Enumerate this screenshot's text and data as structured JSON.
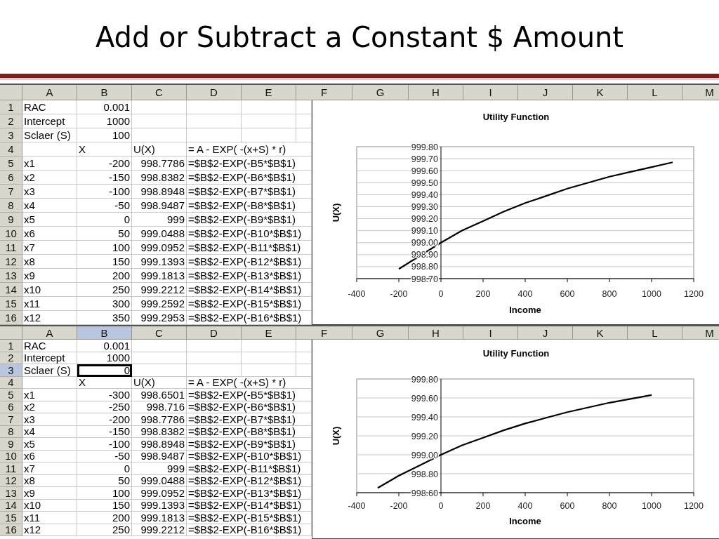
{
  "slide": {
    "title": "Add or Subtract a Constant $ Amount"
  },
  "sheets": [
    {
      "columns": [
        {
          "label": "A",
          "selected": false
        },
        {
          "label": "B",
          "selected": false
        },
        {
          "label": "C",
          "selected": false
        },
        {
          "label": "D",
          "selected": false
        },
        {
          "label": "E",
          "selected": false
        },
        {
          "label": "F",
          "selected": false
        },
        {
          "label": "G",
          "selected": false
        },
        {
          "label": "H",
          "selected": false
        },
        {
          "label": "I",
          "selected": false
        },
        {
          "label": "J",
          "selected": false
        },
        {
          "label": "K",
          "selected": false
        },
        {
          "label": "L",
          "selected": false
        },
        {
          "label": "M",
          "selected": false
        }
      ],
      "rows": [
        {
          "number": "1",
          "kind": "value",
          "selected": false,
          "a": "RAC",
          "b": "0.001"
        },
        {
          "number": "2",
          "kind": "value",
          "selected": false,
          "a": "Intercept",
          "b": "1000"
        },
        {
          "number": "3",
          "kind": "value",
          "selected": false,
          "a": "Sclaer (S)",
          "b": "100"
        },
        {
          "number": "4",
          "kind": "heading",
          "selected": false,
          "b": "X",
          "c": "U(X)",
          "d": "= A - EXP( -(x+S) * r)"
        },
        {
          "number": "5",
          "kind": "value",
          "selected": false,
          "a": "x1",
          "b": "-200",
          "c": "998.7786",
          "d": "=$B$2-EXP(-B5*$B$1)"
        },
        {
          "number": "6",
          "kind": "value",
          "selected": false,
          "a": "x2",
          "b": "-150",
          "c": "998.8382",
          "d": "=$B$2-EXP(-B6*$B$1)"
        },
        {
          "number": "7",
          "kind": "value",
          "selected": false,
          "a": "x3",
          "b": "-100",
          "c": "998.8948",
          "d": "=$B$2-EXP(-B7*$B$1)"
        },
        {
          "number": "8",
          "kind": "value",
          "selected": false,
          "a": "x4",
          "b": "-50",
          "c": "998.9487",
          "d": "=$B$2-EXP(-B8*$B$1)"
        },
        {
          "number": "9",
          "kind": "value",
          "selected": false,
          "a": "x5",
          "b": "0",
          "c": "999",
          "d": "=$B$2-EXP(-B9*$B$1)"
        },
        {
          "number": "10",
          "kind": "value",
          "selected": false,
          "a": "x6",
          "b": "50",
          "c": "999.0488",
          "d": "=$B$2-EXP(-B10*$B$1)"
        },
        {
          "number": "11",
          "kind": "value",
          "selected": false,
          "a": "x7",
          "b": "100",
          "c": "999.0952",
          "d": "=$B$2-EXP(-B11*$B$1)"
        },
        {
          "number": "12",
          "kind": "value",
          "selected": false,
          "a": "x8",
          "b": "150",
          "c": "999.1393",
          "d": "=$B$2-EXP(-B12*$B$1)"
        },
        {
          "number": "13",
          "kind": "value",
          "selected": false,
          "a": "x9",
          "b": "200",
          "c": "999.1813",
          "d": "=$B$2-EXP(-B13*$B$1)"
        },
        {
          "number": "14",
          "kind": "value",
          "selected": false,
          "a": "x10",
          "b": "250",
          "c": "999.2212",
          "d": "=$B$2-EXP(-B14*$B$1)"
        },
        {
          "number": "15",
          "kind": "value",
          "selected": false,
          "a": "x11",
          "b": "300",
          "c": "999.2592",
          "d": "=$B$2-EXP(-B15*$B$1)"
        },
        {
          "number": "16",
          "kind": "value",
          "selected": false,
          "a": "x12",
          "b": "350",
          "c": "999.2953",
          "d": "=$B$2-EXP(-B16*$B$1)"
        }
      ],
      "chart": {
        "chart_data": {
          "type": "line",
          "title": "Utility Function",
          "xlabel": "Income",
          "ylabel": "U(X)",
          "x": [
            -200,
            -100,
            0,
            100,
            200,
            300,
            400,
            500,
            600,
            700,
            800,
            900,
            1000,
            1100
          ],
          "values": [
            998.78,
            998.89,
            999,
            999.1,
            999.18,
            999.26,
            999.33,
            999.39,
            999.45,
            999.5,
            999.55,
            999.59,
            999.63,
            999.67
          ],
          "grid": true,
          "xlim": [
            -400,
            1200
          ],
          "ylim": [
            998.7,
            999.8
          ],
          "xticks": [
            -400,
            -200,
            0,
            200,
            400,
            600,
            800,
            1000,
            1200
          ],
          "yticks": [
            {
              "value": 998.7,
              "label": "998.70"
            },
            {
              "value": 998.8,
              "label": "998.80"
            },
            {
              "value": 998.9,
              "label": "998.90"
            },
            {
              "value": 999.0,
              "label": "999.00"
            },
            {
              "value": 999.1,
              "label": "999.10"
            },
            {
              "value": 999.2,
              "label": "999.20"
            },
            {
              "value": 999.3,
              "label": "999.30"
            },
            {
              "value": 999.4,
              "label": "999.40"
            },
            {
              "value": 999.5,
              "label": "999.50"
            },
            {
              "value": 999.6,
              "label": "999.60"
            },
            {
              "value": 999.7,
              "label": "999.70"
            },
            {
              "value": 999.8,
              "label": "999.80"
            }
          ]
        }
      }
    },
    {
      "columns": [
        {
          "label": "A",
          "selected": false
        },
        {
          "label": "B",
          "selected": true
        },
        {
          "label": "C",
          "selected": false
        },
        {
          "label": "D",
          "selected": false
        },
        {
          "label": "E",
          "selected": false
        },
        {
          "label": "F",
          "selected": false
        },
        {
          "label": "G",
          "selected": false
        },
        {
          "label": "H",
          "selected": false
        },
        {
          "label": "I",
          "selected": false
        },
        {
          "label": "J",
          "selected": false
        },
        {
          "label": "K",
          "selected": false
        },
        {
          "label": "L",
          "selected": false
        },
        {
          "label": "M",
          "selected": false
        }
      ],
      "rows": [
        {
          "number": "1",
          "kind": "value",
          "selected": false,
          "a": "RAC",
          "b": "0.001"
        },
        {
          "number": "2",
          "kind": "value",
          "selected": false,
          "a": "Intercept",
          "b": "1000"
        },
        {
          "number": "3",
          "kind": "value",
          "selected": true,
          "a": "Sclaer (S)",
          "b": "0"
        },
        {
          "number": "4",
          "kind": "heading",
          "selected": false,
          "b": "X",
          "c": "U(X)",
          "d": "= A - EXP( -(x+S) * r)"
        },
        {
          "number": "5",
          "kind": "value",
          "selected": false,
          "a": "x1",
          "b": "-300",
          "c": "998.6501",
          "d": "=$B$2-EXP(-B5*$B$1)"
        },
        {
          "number": "6",
          "kind": "value",
          "selected": false,
          "a": "x2",
          "b": "-250",
          "c": "998.716",
          "d": "=$B$2-EXP(-B6*$B$1)"
        },
        {
          "number": "7",
          "kind": "value",
          "selected": false,
          "a": "x3",
          "b": "-200",
          "c": "998.7786",
          "d": "=$B$2-EXP(-B7*$B$1)"
        },
        {
          "number": "8",
          "kind": "value",
          "selected": false,
          "a": "x4",
          "b": "-150",
          "c": "998.8382",
          "d": "=$B$2-EXP(-B8*$B$1)"
        },
        {
          "number": "9",
          "kind": "value",
          "selected": false,
          "a": "x5",
          "b": "-100",
          "c": "998.8948",
          "d": "=$B$2-EXP(-B9*$B$1)"
        },
        {
          "number": "10",
          "kind": "value",
          "selected": false,
          "a": "x6",
          "b": "-50",
          "c": "998.9487",
          "d": "=$B$2-EXP(-B10*$B$1)"
        },
        {
          "number": "11",
          "kind": "value",
          "selected": false,
          "a": "x7",
          "b": "0",
          "c": "999",
          "d": "=$B$2-EXP(-B11*$B$1)"
        },
        {
          "number": "12",
          "kind": "value",
          "selected": false,
          "a": "x8",
          "b": "50",
          "c": "999.0488",
          "d": "=$B$2-EXP(-B12*$B$1)"
        },
        {
          "number": "13",
          "kind": "value",
          "selected": false,
          "a": "x9",
          "b": "100",
          "c": "999.0952",
          "d": "=$B$2-EXP(-B13*$B$1)"
        },
        {
          "number": "14",
          "kind": "value",
          "selected": false,
          "a": "x10",
          "b": "150",
          "c": "999.1393",
          "d": "=$B$2-EXP(-B14*$B$1)"
        },
        {
          "number": "15",
          "kind": "value",
          "selected": false,
          "a": "x11",
          "b": "200",
          "c": "999.1813",
          "d": "=$B$2-EXP(-B15*$B$1)"
        },
        {
          "number": "16",
          "kind": "value",
          "selected": false,
          "a": "x12",
          "b": "250",
          "c": "999.2212",
          "d": "=$B$2-EXP(-B16*$B$1)"
        }
      ],
      "chart": {
        "chart_data": {
          "type": "line",
          "title": "Utility Function",
          "xlabel": "Income",
          "ylabel": "U(X)",
          "x": [
            -300,
            -200,
            -100,
            0,
            100,
            200,
            300,
            400,
            500,
            600,
            700,
            800,
            900,
            1000
          ],
          "values": [
            998.65,
            998.78,
            998.89,
            999,
            999.1,
            999.18,
            999.26,
            999.33,
            999.39,
            999.45,
            999.5,
            999.55,
            999.59,
            999.63
          ],
          "grid": true,
          "xlim": [
            -400,
            1200
          ],
          "ylim": [
            998.6,
            999.8
          ],
          "xticks": [
            -400,
            -200,
            0,
            200,
            400,
            600,
            800,
            1000,
            1200
          ],
          "yticks": [
            {
              "value": 998.6,
              "label": "998.60"
            },
            {
              "value": 998.8,
              "label": "998.80"
            },
            {
              "value": 999.0,
              "label": "999.00"
            },
            {
              "value": 999.2,
              "label": "999.20"
            },
            {
              "value": 999.4,
              "label": "999.40"
            },
            {
              "value": 999.6,
              "label": "999.60"
            },
            {
              "value": 999.8,
              "label": "999.80"
            }
          ]
        }
      }
    }
  ]
}
